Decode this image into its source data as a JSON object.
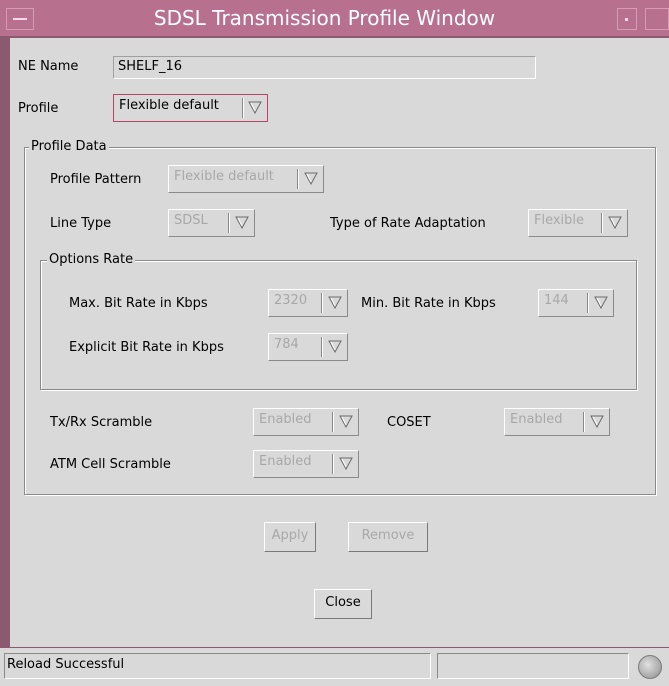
{
  "window": {
    "title": "SDSL Transmission Profile Window"
  },
  "ne": {
    "label": "NE Name",
    "value": "SHELF_16"
  },
  "profile": {
    "label": "Profile",
    "selected": "Flexible default"
  },
  "profile_data": {
    "title": "Profile Data",
    "pattern": {
      "label": "Profile Pattern",
      "value": "Flexible default"
    },
    "line_type": {
      "label": "Line Type",
      "value": "SDSL"
    },
    "rate_adaptation": {
      "label": "Type of Rate Adaptation",
      "value": "Flexible"
    },
    "options_rate": {
      "title": "Options Rate",
      "max_bit_rate": {
        "label": "Max. Bit Rate in Kbps",
        "value": "2320"
      },
      "min_bit_rate": {
        "label": "Min. Bit Rate in Kbps",
        "value": "144"
      },
      "explicit_bit_rate": {
        "label": "Explicit Bit Rate in Kbps",
        "value": "784"
      }
    },
    "tx_rx_scramble": {
      "label": "Tx/Rx Scramble",
      "value": "Enabled"
    },
    "coset": {
      "label": "COSET",
      "value": "Enabled"
    },
    "atm_cell_scramble": {
      "label": "ATM Cell Scramble",
      "value": "Enabled"
    }
  },
  "buttons": {
    "apply": "Apply",
    "remove": "Remove",
    "close": "Close"
  },
  "status": {
    "message": "Reload Successful",
    "secondary": ""
  },
  "colors": {
    "titlebar": "#b7718f",
    "frame": "#8c5a70",
    "panel": "#d9d9d9",
    "disabled_text": "#a8a8a8"
  },
  "icons": [
    "window-menu-icon",
    "minimize-icon",
    "maximize-icon",
    "dropdown-arrow-icon",
    "status-led-icon"
  ]
}
